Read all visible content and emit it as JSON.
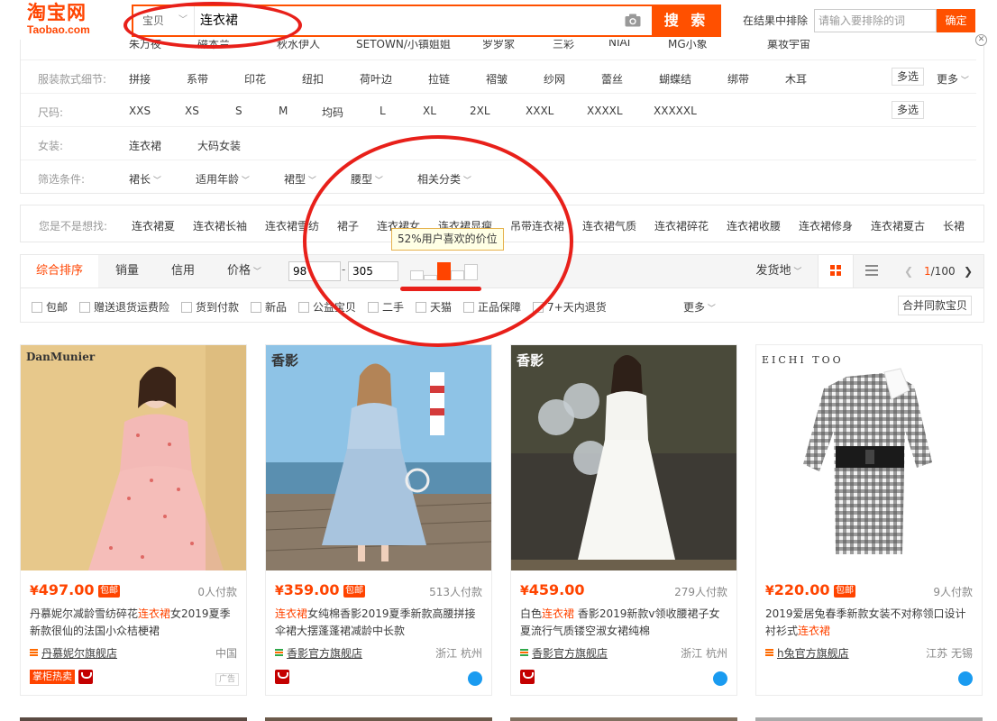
{
  "header": {
    "logo_cn": "淘宝网",
    "logo_en": "Taobao.com",
    "search_scope": "宝贝",
    "search_query": "连衣裙",
    "search_button": "搜 索",
    "exclude_label": "在结果中排除",
    "exclude_placeholder": "请输入要排除的词",
    "exclude_confirm": "确定"
  },
  "filters": {
    "brand_row": [
      "朱万夜",
      "磁本兰",
      "秋水伊人",
      "SETOWN/小镇姐姐",
      "罗罗家",
      "三彩",
      "NIAI",
      "MG小象",
      "菓妆宇宙"
    ],
    "detail": {
      "label": "服装款式细节:",
      "options": [
        "拼接",
        "系带",
        "印花",
        "纽扣",
        "荷叶边",
        "拉链",
        "褶皱",
        "纱网",
        "蕾丝",
        "蝴蝶结",
        "绑带",
        "木耳"
      ],
      "multi": "多选",
      "more": "更多"
    },
    "size": {
      "label": "尺码:",
      "options": [
        "XXS",
        "XS",
        "S",
        "M",
        "均码",
        "L",
        "XL",
        "2XL",
        "XXXL",
        "XXXXL",
        "XXXXXL"
      ],
      "multi": "多选"
    },
    "women": {
      "label": "女装:",
      "options": [
        "连衣裙",
        "大码女装"
      ]
    },
    "conditions": {
      "label": "筛选条件:",
      "options": [
        "裙长",
        "适用年龄",
        "裙型",
        "腰型",
        "相关分类"
      ]
    }
  },
  "suggest": {
    "label": "您是不是想找:",
    "items": [
      "连衣裙夏",
      "连衣裙长袖",
      "连衣裙雪纺",
      "裙子",
      "连衣裙女",
      "连衣裙显瘦",
      "吊带连衣裙",
      "连衣裙气质",
      "连衣裙碎花",
      "连衣裙收腰",
      "连衣裙修身",
      "连衣裙夏古",
      "长裙"
    ]
  },
  "sort": {
    "tabs": [
      "综合排序",
      "销量",
      "信用",
      "价格"
    ],
    "price_min": "98",
    "price_sep": "-",
    "price_max": "305",
    "tooltip": "52%用户喜欢的价位",
    "ship_from": "发货地",
    "page_current": "1",
    "page_total": "/100",
    "histogram": [
      0.55,
      0.3,
      1.0,
      0.55,
      0.9
    ],
    "active_bucket": 2
  },
  "checks": {
    "items": [
      "包邮",
      "赠送退货运费险",
      "货到付款",
      "新品",
      "公益宝贝",
      "二手",
      "天猫",
      "正品保障",
      "7+天内退货"
    ],
    "more": "更多",
    "merge": "合并同款宝贝"
  },
  "products": [
    {
      "brand": "DanMunier",
      "price": "497.00",
      "free_ship": "包邮",
      "paid": "0人付款",
      "title_pre": "丹慕妮尔减龄雪纺碎花",
      "title_hl": "连衣裙",
      "title_post": "女2019夏季新款很仙的法国小众桔梗裙",
      "shop": "丹慕妮尔旗舰店",
      "location": "中国",
      "promo": "掌柜热卖",
      "ad": "广告"
    },
    {
      "brand": "香影",
      "price": "359.00",
      "free_ship": "包邮",
      "paid": "513人付款",
      "title_pre": "",
      "title_hl": "连衣裙",
      "title_post": "女纯棉香影2019夏季新款高腰拼接伞裙大摆蓬蓬裙减龄中长款",
      "shop": "香影官方旗舰店",
      "location": "浙江 杭州"
    },
    {
      "brand": "香影",
      "price": "459.00",
      "free_ship": "",
      "paid": "279人付款",
      "title_pre": "白色",
      "title_hl": "连衣裙",
      "title_post": " 香影2019新款v领收腰裙子女夏流行气质镂空淑女裙纯棉",
      "shop": "香影官方旗舰店",
      "location": "浙江 杭州"
    },
    {
      "brand": "EICHI TOO",
      "price": "220.00",
      "free_ship": "包邮",
      "paid": "9人付款",
      "title_pre": "2019爱居兔春季新款女装不对称领口设计衬衫式",
      "title_hl": "连衣裙",
      "title_post": "",
      "shop": "h兔官方旗舰店",
      "location": "江苏 无锡"
    }
  ],
  "colors": {
    "accent": "#ff4400",
    "annotation": "#e8201a"
  }
}
